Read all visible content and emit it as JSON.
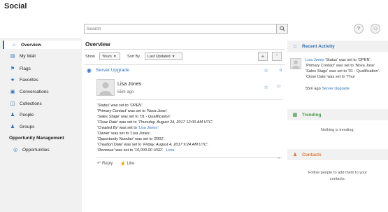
{
  "app": {
    "title": "Social"
  },
  "search": {
    "placeholder": "Search"
  },
  "header": {
    "help_label": "?",
    "window_label": "□"
  },
  "sidebar": {
    "items": [
      {
        "label": "Overview",
        "icon": "home-icon"
      },
      {
        "label": "My Wall",
        "icon": "wall-icon"
      },
      {
        "label": "Flags",
        "icon": "flag-icon"
      },
      {
        "label": "Favorites",
        "icon": "star-icon"
      },
      {
        "label": "Conversations",
        "icon": "conversations-icon"
      },
      {
        "label": "Collections",
        "icon": "collections-icon"
      },
      {
        "label": "People",
        "icon": "people-icon"
      },
      {
        "label": "Groups",
        "icon": "groups-icon"
      }
    ],
    "section_title": "Opportunity Management",
    "sub_items": [
      {
        "label": "Opportunities",
        "icon": "opportunity-icon"
      }
    ]
  },
  "main": {
    "title": "Overview",
    "show_label": "Show",
    "show_value": "Yours",
    "sort_label": "Sort By",
    "sort_value": "Last Updated",
    "post": {
      "group": "Server Upgrade",
      "group_count": "0",
      "author": "Lisa Jones",
      "time": "55m ago",
      "lines": [
        {
          "pre": "'Status'",
          "mid": " was set to ",
          "val": "'OPEN'."
        },
        {
          "pre": "'Primary Contact'",
          "mid": " was set to ",
          "val": "'Nova Jose'."
        },
        {
          "pre": "'Sales Stage'",
          "mid": " was set to ",
          "val": "'01 - Qualification'."
        },
        {
          "pre": "'Close Date'",
          "mid": " was set to ",
          "val": "'Thursday, August 24, 2017 12:00 AM UTC'."
        },
        {
          "pre": "'Created By'",
          "mid": " was set to ",
          "val": "'Lisa Jones'"
        },
        {
          "pre": "'Owner'",
          "mid": " was set to ",
          "val": "'Lisa Jones'."
        },
        {
          "pre": "'Opportunity Number'",
          "mid": " was set to ",
          "val": "'2001'."
        },
        {
          "pre": "'Creation Date'",
          "mid": " was set to ",
          "val": "'Friday, August 4, 2017 9:24 AM UTC'."
        },
        {
          "pre": "'Revenue'",
          "mid": " was set to ",
          "val": "'10,000.00 USD'."
        }
      ],
      "less_label": "Less",
      "reply_label": "Reply",
      "like_label": "Like"
    }
  },
  "right": {
    "recent": {
      "title": "Recent Activity",
      "author": "Lisa Jones",
      "text1": " 'Status' was set to",
      "text2": "'OPEN'. 'Primary Contact'",
      "text3": "was set to 'Nova Jose'. 'Sales Stage'",
      "text4": "was set to '01 - Qualification'. 'Close Date' was set to 'Thur",
      "time": "55m ago",
      "group": "Server Upgrade"
    },
    "trending": {
      "title": "Trending",
      "empty": "Nothing is trending."
    },
    "contacts": {
      "title": "Contacts",
      "empty1": "Follow people to add them to your",
      "empty2": "contacts."
    }
  },
  "colors": {
    "accent": "#2a6fb6",
    "contacts": "#e07b39",
    "trending": "#4a9a4a"
  }
}
